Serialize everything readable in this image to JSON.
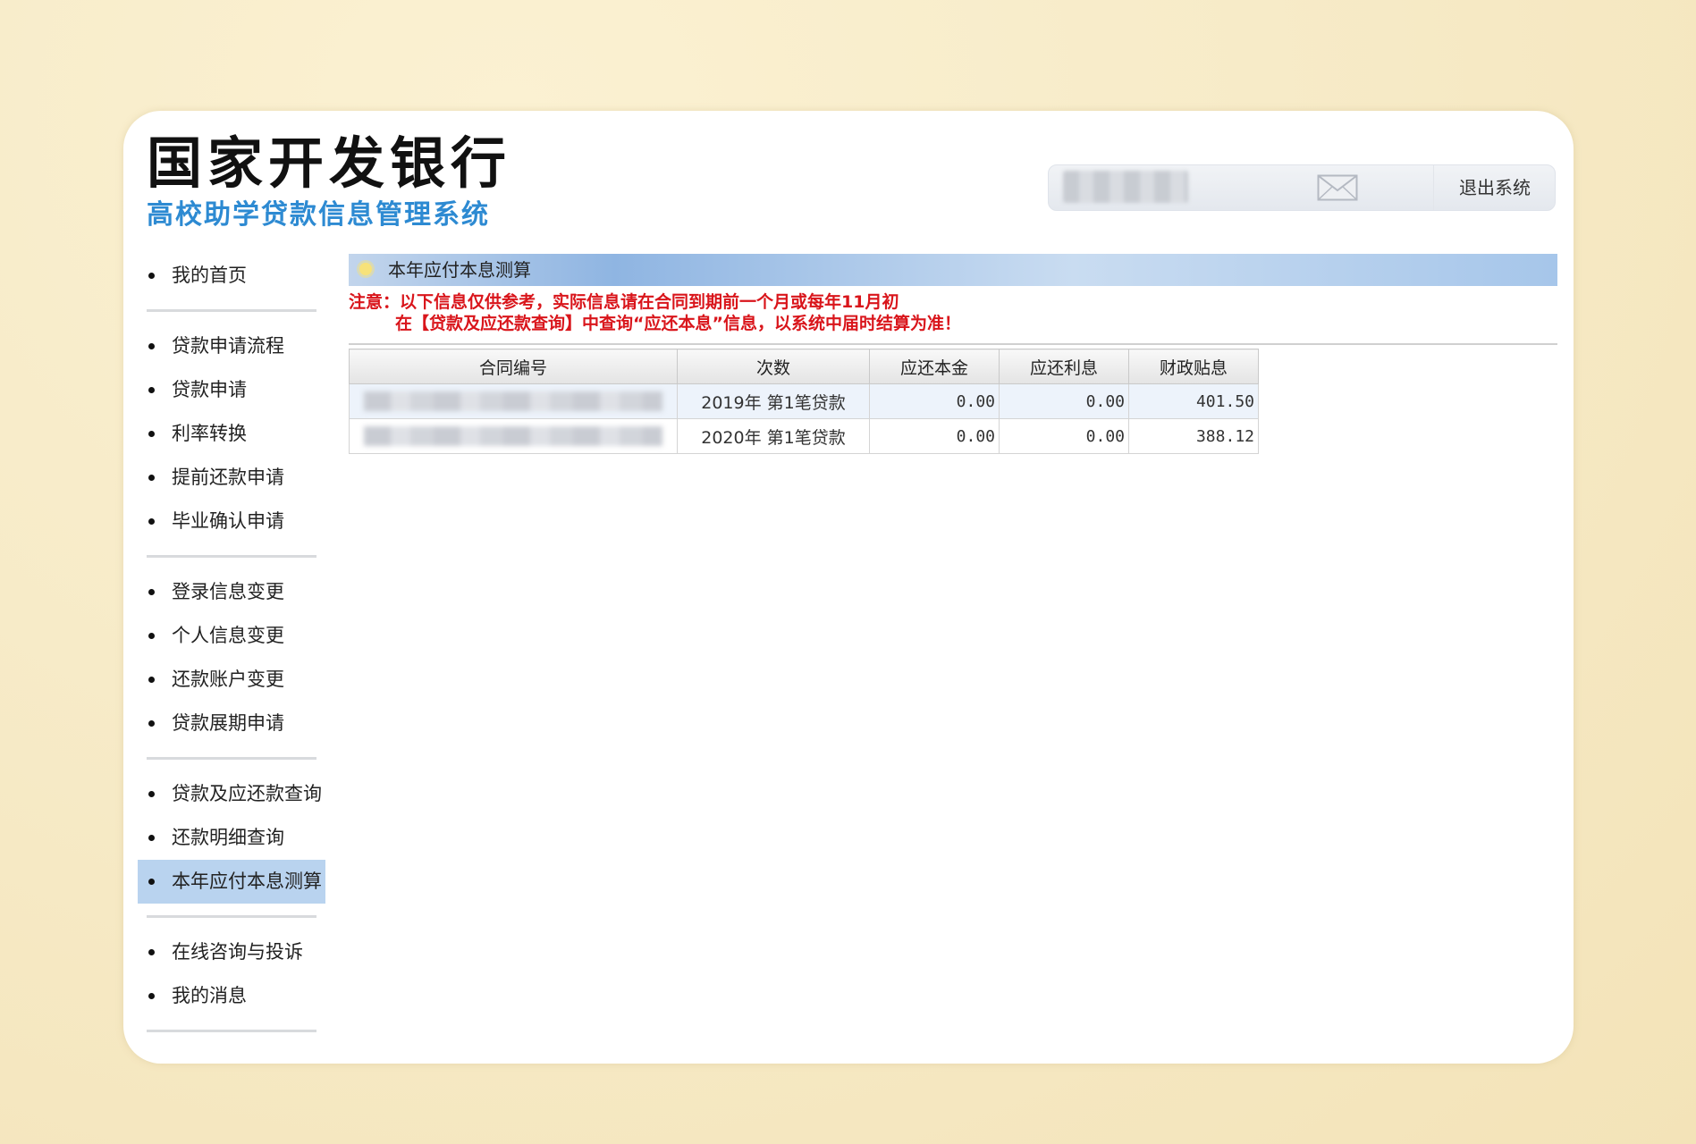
{
  "brand": {
    "title": "国家开发银行",
    "subtitle": "高校助学贷款信息管理系统"
  },
  "userbar": {
    "logout_label": "退出系统",
    "mail_icon": "mail-icon"
  },
  "sidebar": {
    "groups": [
      [
        {
          "label": "我的首页"
        }
      ],
      [
        {
          "label": "贷款申请流程"
        },
        {
          "label": "贷款申请"
        },
        {
          "label": "利率转换"
        },
        {
          "label": "提前还款申请"
        },
        {
          "label": "毕业确认申请"
        }
      ],
      [
        {
          "label": "登录信息变更"
        },
        {
          "label": "个人信息变更"
        },
        {
          "label": "还款账户变更"
        },
        {
          "label": "贷款展期申请"
        }
      ],
      [
        {
          "label": "贷款及应还款查询"
        },
        {
          "label": "还款明细查询"
        },
        {
          "label": "本年应付本息测算",
          "active": true
        }
      ],
      [
        {
          "label": "在线咨询与投诉"
        },
        {
          "label": "我的消息"
        }
      ]
    ]
  },
  "main": {
    "section_title": "本年应付本息测算",
    "notice_line1": "注意：以下信息仅供参考，实际信息请在合同到期前一个月或每年11月初",
    "notice_line2": "在【贷款及应还款查询】中查询“应还本息”信息，以系统中届时结算为准！",
    "table": {
      "headers": [
        "合同编号",
        "次数",
        "应还本金",
        "应还利息",
        "财政贴息"
      ],
      "rows": [
        {
          "contract": "",
          "count": "2019年 第1笔贷款",
          "principal": "0.00",
          "interest": "0.00",
          "subsidy": "401.50"
        },
        {
          "contract": "",
          "count": "2020年 第1笔贷款",
          "principal": "0.00",
          "interest": "0.00",
          "subsidy": "388.12"
        }
      ]
    }
  },
  "colors": {
    "brand_blue": "#2d8ad2",
    "notice_red": "#d9151b",
    "active_nav": "#b9d3ef"
  }
}
